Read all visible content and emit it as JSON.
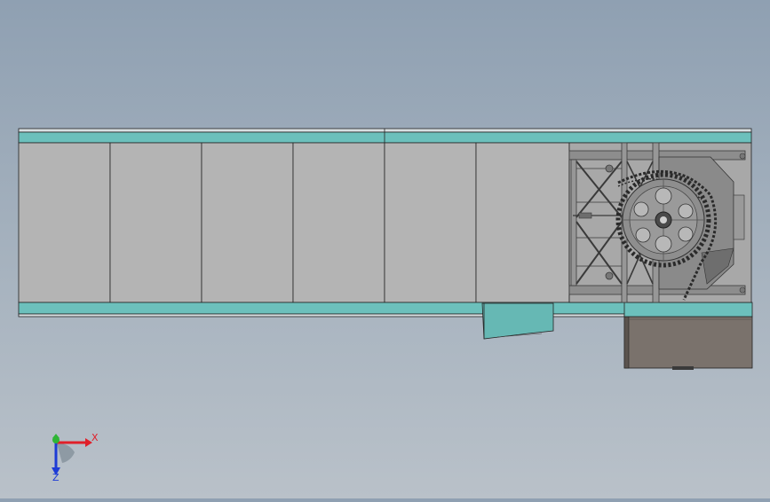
{
  "scene": {
    "colors": {
      "background_top": "#8fa0b2",
      "background_bottom": "#b9c1c9",
      "panel_gray": "#b4b4b4",
      "rail_teal": "#6cc0bc",
      "hopper_teal": "#66b8b4",
      "motor_box": "#7a726c",
      "frame_dark": "#3a3a3a",
      "sprocket": "#8e8e8e"
    },
    "labels": {
      "panel_count": 6
    }
  },
  "triad": {
    "x_label": "X",
    "z_label": "Z",
    "colors": {
      "x": "#e0202a",
      "y": "#2fb536",
      "z": "#1d3bd6"
    }
  }
}
